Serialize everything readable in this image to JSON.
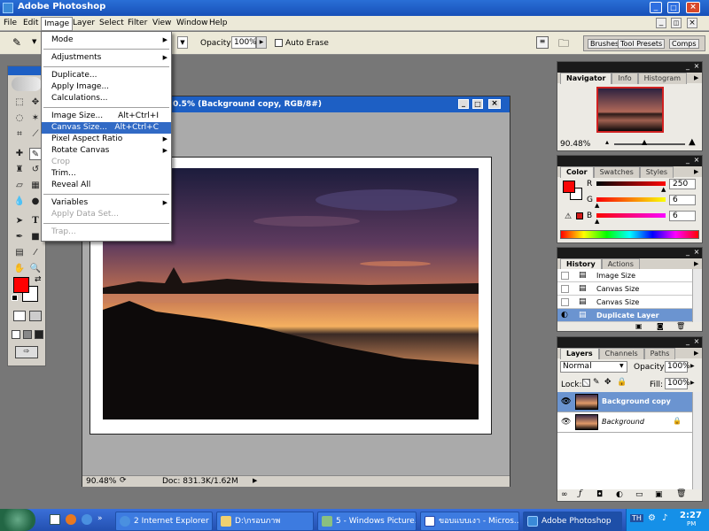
{
  "window": {
    "title": "Adobe Photoshop"
  },
  "menubar": [
    "File",
    "Edit",
    "Image",
    "Layer",
    "Select",
    "Filter",
    "View",
    "Window",
    "Help"
  ],
  "options": {
    "opacity_label": "Opacity:",
    "opacity_value": "100%",
    "auto_erase": "Auto Erase",
    "well_tabs": [
      "Brushes",
      "Tool Presets",
      "Comps"
    ]
  },
  "image_menu": {
    "items": [
      {
        "label": "Mode",
        "submenu": true
      },
      {
        "sep": true
      },
      {
        "label": "Adjustments",
        "submenu": true
      },
      {
        "sep": true
      },
      {
        "label": "Duplicate..."
      },
      {
        "label": "Apply Image..."
      },
      {
        "label": "Calculations..."
      },
      {
        "sep": true
      },
      {
        "label": "Image Size...",
        "shortcut": "Alt+Ctrl+I"
      },
      {
        "label": "Canvas Size...",
        "shortcut": "Alt+Ctrl+C",
        "highlight": true
      },
      {
        "label": "Pixel Aspect Ratio",
        "submenu": true
      },
      {
        "label": "Rotate Canvas",
        "submenu": true
      },
      {
        "label": "Crop",
        "disabled": true
      },
      {
        "label": "Trim..."
      },
      {
        "label": "Reveal All"
      },
      {
        "sep": true
      },
      {
        "label": "Variables",
        "submenu": true
      },
      {
        "label": "Apply Data Set...",
        "disabled": true
      },
      {
        "sep": true
      },
      {
        "label": "Trap...",
        "disabled": true
      }
    ]
  },
  "document": {
    "title": "0.5% (Background copy, RGB/8#)",
    "zoom": "90.48%",
    "doc_info": "Doc: 831.3K/1.62M"
  },
  "navigator": {
    "tabs": [
      "Navigator",
      "Info",
      "Histogram"
    ],
    "zoom": "90.48%"
  },
  "color": {
    "tabs": [
      "Color",
      "Swatches",
      "Styles"
    ],
    "channels": [
      {
        "label": "R",
        "value": "250",
        "pct": 0.98
      },
      {
        "label": "G",
        "value": "6",
        "pct": 0.02
      },
      {
        "label": "B",
        "value": "6",
        "pct": 0.02
      }
    ],
    "fg": "#fa0606"
  },
  "history": {
    "tabs": [
      "History",
      "Actions"
    ],
    "items": [
      "Image Size",
      "Canvas Size",
      "Canvas Size",
      "Duplicate Layer"
    ]
  },
  "layers": {
    "tabs": [
      "Layers",
      "Channels",
      "Paths"
    ],
    "blend": "Normal",
    "opacity_label": "Opacity:",
    "opacity": "100%",
    "lock_label": "Lock:",
    "fill_label": "Fill:",
    "fill": "100%",
    "items": [
      "Background copy",
      "Background"
    ]
  },
  "taskbar": {
    "buttons": [
      "2 Internet Explorer",
      "D:\\กรอบภาพ",
      "5 - Windows Picture...",
      "ขอบแบบเงา - Micros...",
      "Adobe Photoshop"
    ],
    "tray_lang": "TH",
    "clock": "2:27",
    "clock_sub": "PM"
  },
  "colors": {
    "title_blue": "#1d5fc4",
    "menu_highlight": "#316ac5",
    "fg_red": "#ff0000"
  }
}
